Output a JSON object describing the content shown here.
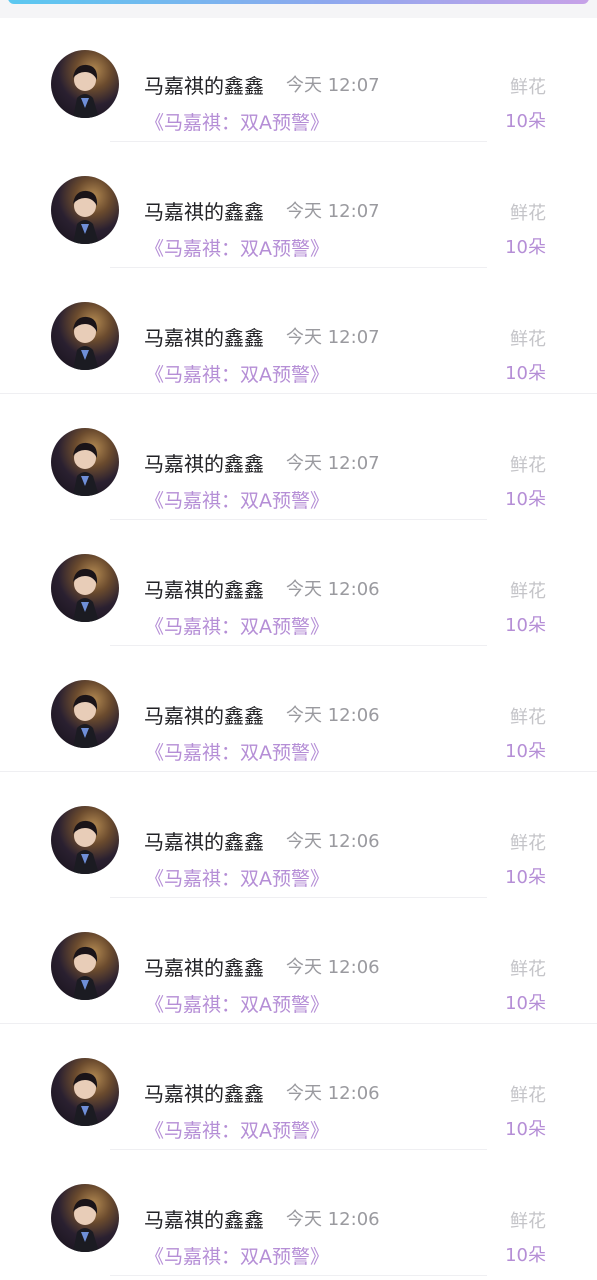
{
  "records": [
    {
      "user": "马嘉祺的鑫鑫",
      "time": "今天 12:07",
      "book": "《马嘉祺：双A预警》",
      "gift_label": "鲜花",
      "gift_count": "10朵"
    },
    {
      "user": "马嘉祺的鑫鑫",
      "time": "今天 12:07",
      "book": "《马嘉祺：双A预警》",
      "gift_label": "鲜花",
      "gift_count": "10朵"
    },
    {
      "user": "马嘉祺的鑫鑫",
      "time": "今天 12:07",
      "book": "《马嘉祺：双A预警》",
      "gift_label": "鲜花",
      "gift_count": "10朵"
    },
    {
      "user": "马嘉祺的鑫鑫",
      "time": "今天 12:07",
      "book": "《马嘉祺：双A预警》",
      "gift_label": "鲜花",
      "gift_count": "10朵"
    },
    {
      "user": "马嘉祺的鑫鑫",
      "time": "今天 12:06",
      "book": "《马嘉祺：双A预警》",
      "gift_label": "鲜花",
      "gift_count": "10朵"
    },
    {
      "user": "马嘉祺的鑫鑫",
      "time": "今天 12:06",
      "book": "《马嘉祺：双A预警》",
      "gift_label": "鲜花",
      "gift_count": "10朵"
    },
    {
      "user": "马嘉祺的鑫鑫",
      "time": "今天 12:06",
      "book": "《马嘉祺：双A预警》",
      "gift_label": "鲜花",
      "gift_count": "10朵"
    },
    {
      "user": "马嘉祺的鑫鑫",
      "time": "今天 12:06",
      "book": "《马嘉祺：双A预警》",
      "gift_label": "鲜花",
      "gift_count": "10朵"
    },
    {
      "user": "马嘉祺的鑫鑫",
      "time": "今天 12:06",
      "book": "《马嘉祺：双A预警》",
      "gift_label": "鲜花",
      "gift_count": "10朵"
    },
    {
      "user": "马嘉祺的鑫鑫",
      "time": "今天 12:06",
      "book": "《马嘉祺：双A预警》",
      "gift_label": "鲜花",
      "gift_count": "10朵"
    }
  ],
  "colors": {
    "top_bar_start": "#5bc8f0",
    "top_bar_end": "#c7a2e8",
    "accent_purple": "#b58ed6",
    "name_text": "#222226",
    "muted_text": "#9a9a9f"
  }
}
